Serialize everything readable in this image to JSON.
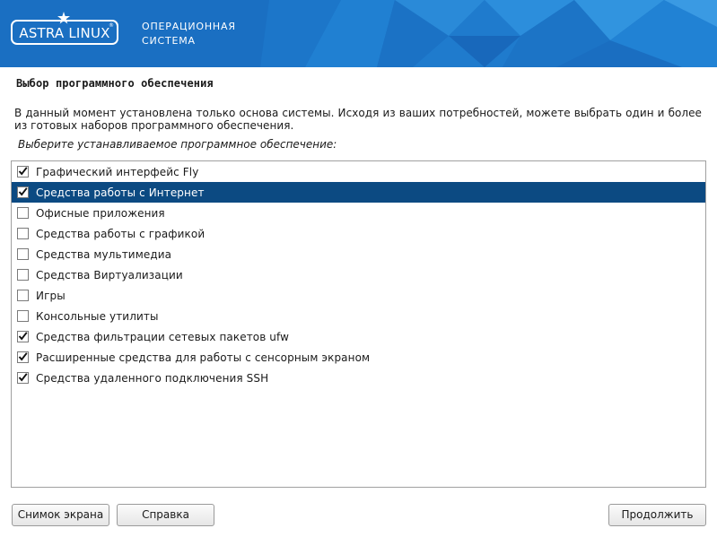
{
  "banner": {
    "logo_text": "ASTRA LINUX",
    "logo_reg": "®",
    "subtitle_line1": "ОПЕРАЦИОННАЯ",
    "subtitle_line2": "СИСТЕМА",
    "colors": {
      "background": "#1a6fc2",
      "accent": "#ffffff"
    }
  },
  "page": {
    "title": "Выбор программного обеспечения",
    "description": "В данный момент установлена только основа системы. Исходя из ваших потребностей, можете выбрать один и более из готовых наборов программного обеспечения.",
    "instruction": "Выберите устанавливаемое программное обеспечение:"
  },
  "software_list": {
    "items": [
      {
        "label": "Графический интерфейс Fly",
        "checked": true,
        "selected": false
      },
      {
        "label": "Средства работы с Интернет",
        "checked": true,
        "selected": true
      },
      {
        "label": "Офисные приложения",
        "checked": false,
        "selected": false
      },
      {
        "label": "Средства работы с графикой",
        "checked": false,
        "selected": false
      },
      {
        "label": "Средства мультимедиа",
        "checked": false,
        "selected": false
      },
      {
        "label": "Средства Виртуализации",
        "checked": false,
        "selected": false
      },
      {
        "label": "Игры",
        "checked": false,
        "selected": false
      },
      {
        "label": "Консольные утилиты",
        "checked": false,
        "selected": false
      },
      {
        "label": "Средства фильтрации сетевых пакетов ufw",
        "checked": true,
        "selected": false
      },
      {
        "label": "Расширенные средства для работы с сенсорным экраном",
        "checked": true,
        "selected": false
      },
      {
        "label": "Средства удаленного подключения SSH",
        "checked": true,
        "selected": false
      }
    ],
    "selection_color": "#0c4a82"
  },
  "buttons": {
    "screenshot_label": "Снимок экрана",
    "help_label": "Справка",
    "continue_label": "Продолжить"
  }
}
